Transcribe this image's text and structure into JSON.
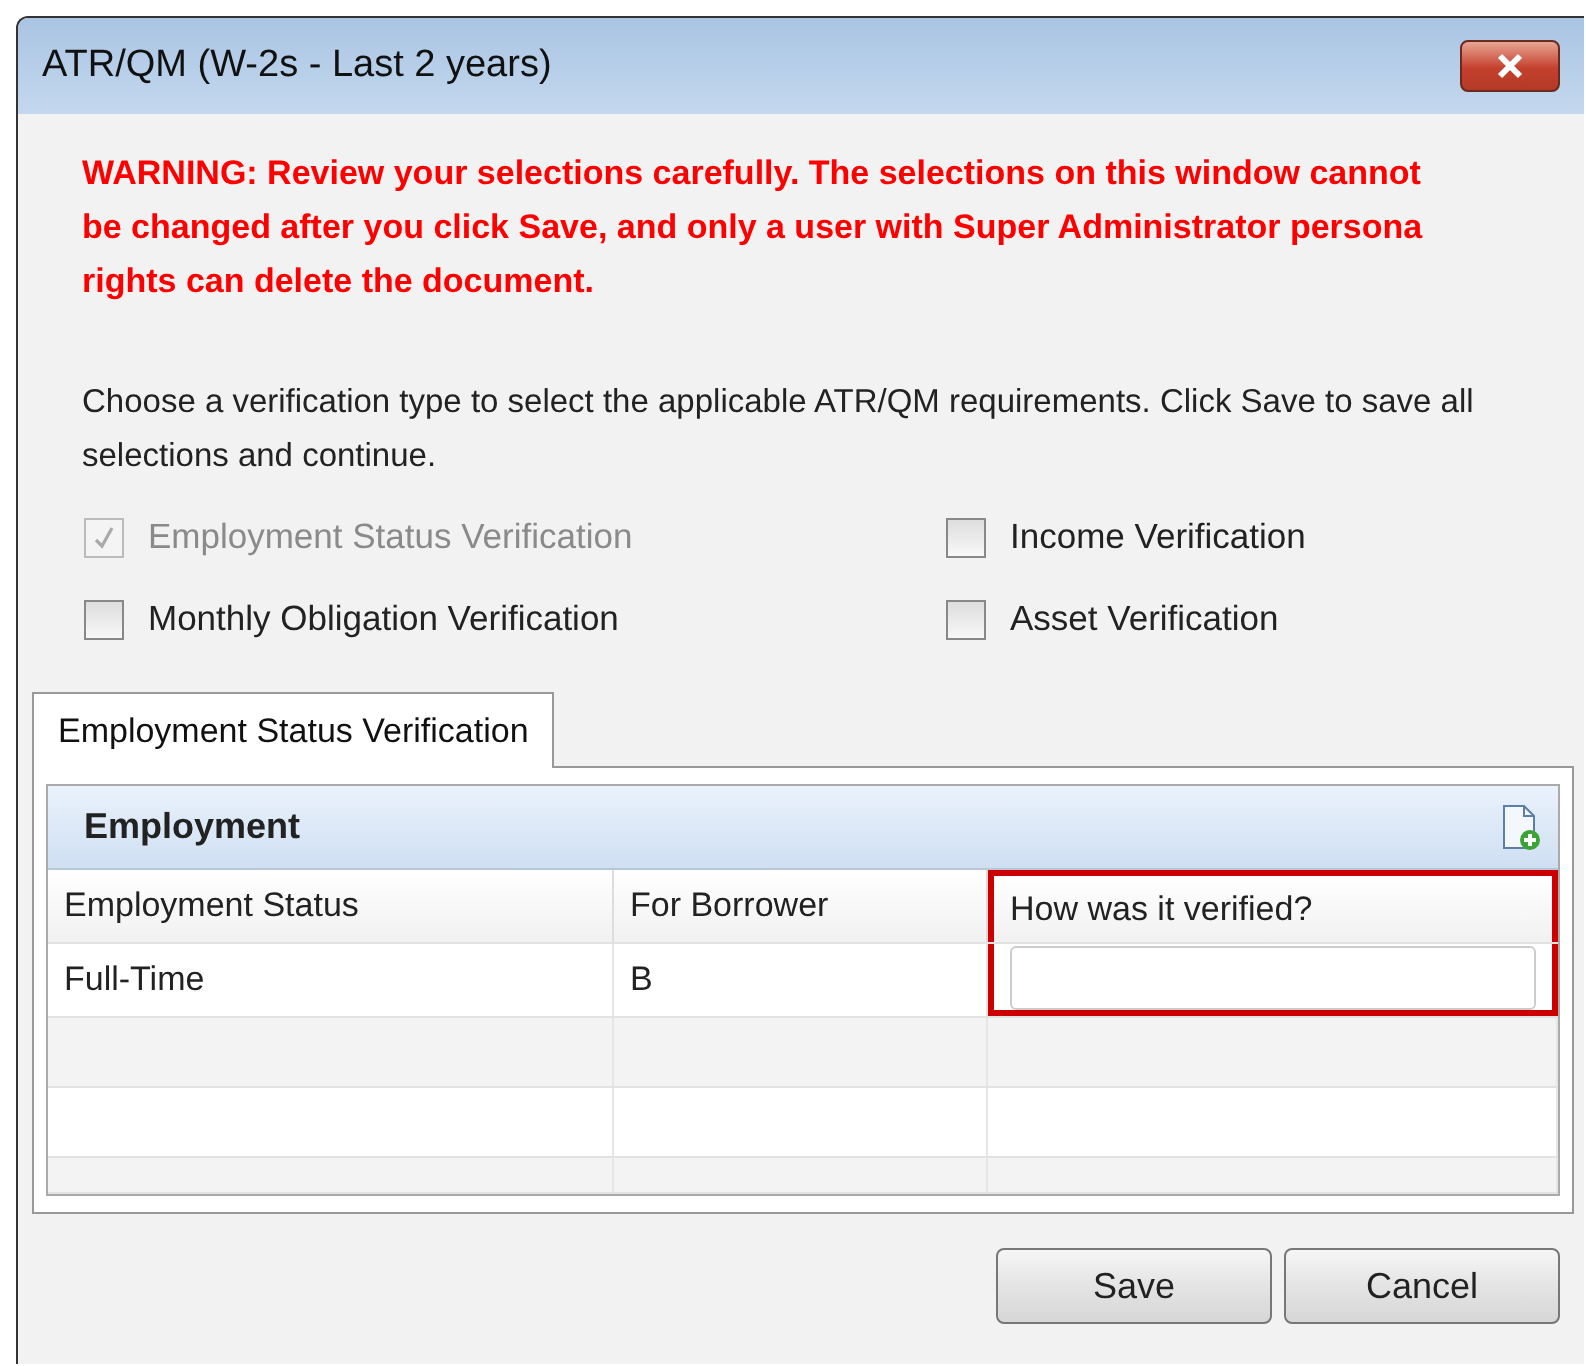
{
  "window": {
    "title": "ATR/QM (W-2s - Last 2 years)"
  },
  "warning": "WARNING: Review your selections carefully. The selections on this window cannot be changed after you click Save, and only a user with Super Administrator persona rights can delete the document.",
  "instruction": "Choose a verification type to select the applicable ATR/QM requirements. Click Save to save all selections and continue.",
  "options": [
    {
      "label": "Employment Status Verification",
      "checked": true,
      "disabled": true
    },
    {
      "label": "Income Verification",
      "checked": false,
      "disabled": false
    },
    {
      "label": "Monthly Obligation Verification",
      "checked": false,
      "disabled": false
    },
    {
      "label": "Asset Verification",
      "checked": false,
      "disabled": false
    }
  ],
  "tabs": [
    {
      "label": "Employment Status Verification",
      "selected": true
    }
  ],
  "grid": {
    "title": "Employment",
    "columns": [
      {
        "label": "Employment Status",
        "highlighted": false
      },
      {
        "label": "For Borrower",
        "highlighted": false
      },
      {
        "label": "How was it verified?",
        "highlighted": true
      }
    ],
    "rows": [
      {
        "cells": [
          {
            "kind": "text",
            "value": "Full-Time"
          },
          {
            "kind": "text",
            "value": "B"
          },
          {
            "kind": "input"
          }
        ]
      }
    ]
  },
  "buttons": [
    "Save",
    "Cancel"
  ]
}
